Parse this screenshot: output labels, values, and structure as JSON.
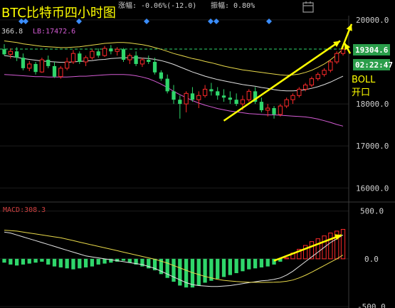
{
  "header": {
    "title": "BTC比特币四小时图",
    "change_label": "涨幅:",
    "change_value": "-0.06%(-12.0)",
    "amplitude_label": "振幅:",
    "amplitude_value": "0.80%",
    "boll_mid_partial": "366.8",
    "boll_lb": "LB:17472.6",
    "icon_name": "calendar-icon"
  },
  "price_axis": {
    "ticks": [
      "20000.0",
      "19304.6",
      "18000.0",
      "17000.0",
      "16000.0"
    ],
    "current_price": "19304.6",
    "countdown": "02:22:47"
  },
  "annotation": {
    "line1": "BOLL",
    "line2": "开口"
  },
  "macd": {
    "label": "MACD:308.3",
    "ticks": [
      "500.0",
      "0.0",
      "-500.0"
    ]
  },
  "colors": {
    "up": "#ff2a2a",
    "down": "#2fd66b",
    "boll_mid": "#e0e0e0",
    "boll_upper": "#e8d94a",
    "boll_lower": "#d45cd4",
    "arrow": "#ffff00",
    "diamond": "#3a8dff",
    "price_tag": "#2a9d4a"
  },
  "chart_data": {
    "type": "candlestick",
    "title": "BTC比特币四小时图",
    "ylim": [
      15700,
      20100
    ],
    "candles": [
      {
        "o": 19300,
        "h": 19420,
        "l": 19150,
        "c": 19180
      },
      {
        "o": 19180,
        "h": 19320,
        "l": 19080,
        "c": 19250
      },
      {
        "o": 19250,
        "h": 19350,
        "l": 19020,
        "c": 19100
      },
      {
        "o": 19100,
        "h": 19200,
        "l": 18800,
        "c": 18850
      },
      {
        "o": 18850,
        "h": 19020,
        "l": 18780,
        "c": 18950
      },
      {
        "o": 18950,
        "h": 19000,
        "l": 18700,
        "c": 18760
      },
      {
        "o": 18760,
        "h": 19100,
        "l": 18740,
        "c": 19050
      },
      {
        "o": 19050,
        "h": 19150,
        "l": 18850,
        "c": 18900
      },
      {
        "o": 18900,
        "h": 19000,
        "l": 18620,
        "c": 18650
      },
      {
        "o": 18650,
        "h": 18900,
        "l": 18600,
        "c": 18850
      },
      {
        "o": 18850,
        "h": 19100,
        "l": 18800,
        "c": 19000
      },
      {
        "o": 19000,
        "h": 19280,
        "l": 18950,
        "c": 19200
      },
      {
        "o": 19200,
        "h": 19250,
        "l": 18950,
        "c": 19000
      },
      {
        "o": 19000,
        "h": 19150,
        "l": 18900,
        "c": 19100
      },
      {
        "o": 19100,
        "h": 19300,
        "l": 19050,
        "c": 19250
      },
      {
        "o": 19250,
        "h": 19320,
        "l": 19100,
        "c": 19150
      },
      {
        "o": 19150,
        "h": 19380,
        "l": 19120,
        "c": 19320
      },
      {
        "o": 19320,
        "h": 19400,
        "l": 19180,
        "c": 19250
      },
      {
        "o": 19250,
        "h": 19350,
        "l": 19150,
        "c": 19300
      },
      {
        "o": 19300,
        "h": 19330,
        "l": 19000,
        "c": 19050
      },
      {
        "o": 19050,
        "h": 19200,
        "l": 18950,
        "c": 19150
      },
      {
        "o": 19150,
        "h": 19250,
        "l": 18900,
        "c": 18950
      },
      {
        "o": 18950,
        "h": 19100,
        "l": 18880,
        "c": 19050
      },
      {
        "o": 19050,
        "h": 19150,
        "l": 18950,
        "c": 19000
      },
      {
        "o": 19000,
        "h": 19100,
        "l": 18700,
        "c": 18750
      },
      {
        "o": 18750,
        "h": 18800,
        "l": 18550,
        "c": 18600
      },
      {
        "o": 18600,
        "h": 18700,
        "l": 18250,
        "c": 18300
      },
      {
        "o": 18300,
        "h": 18450,
        "l": 18000,
        "c": 18100
      },
      {
        "o": 18100,
        "h": 18200,
        "l": 17650,
        "c": 18000
      },
      {
        "o": 18000,
        "h": 18300,
        "l": 17800,
        "c": 18250
      },
      {
        "o": 18250,
        "h": 18400,
        "l": 18050,
        "c": 18100
      },
      {
        "o": 18100,
        "h": 18300,
        "l": 17900,
        "c": 18200
      },
      {
        "o": 18200,
        "h": 18450,
        "l": 18150,
        "c": 18350
      },
      {
        "o": 18350,
        "h": 18500,
        "l": 18200,
        "c": 18300
      },
      {
        "o": 18300,
        "h": 18400,
        "l": 18100,
        "c": 18200
      },
      {
        "o": 18200,
        "h": 18350,
        "l": 18050,
        "c": 18150
      },
      {
        "o": 18150,
        "h": 18300,
        "l": 18000,
        "c": 18100
      },
      {
        "o": 18100,
        "h": 18250,
        "l": 17950,
        "c": 18000
      },
      {
        "o": 18000,
        "h": 18200,
        "l": 17850,
        "c": 18100
      },
      {
        "o": 18100,
        "h": 18350,
        "l": 18050,
        "c": 18300
      },
      {
        "o": 18300,
        "h": 18400,
        "l": 18000,
        "c": 18050
      },
      {
        "o": 18050,
        "h": 18150,
        "l": 17800,
        "c": 17850
      },
      {
        "o": 17850,
        "h": 18000,
        "l": 17700,
        "c": 17900
      },
      {
        "o": 17900,
        "h": 17950,
        "l": 17650,
        "c": 17750
      },
      {
        "o": 17750,
        "h": 18000,
        "l": 17700,
        "c": 17950
      },
      {
        "o": 17950,
        "h": 18150,
        "l": 17900,
        "c": 18100
      },
      {
        "o": 18100,
        "h": 18250,
        "l": 18000,
        "c": 18200
      },
      {
        "o": 18200,
        "h": 18400,
        "l": 18150,
        "c": 18350
      },
      {
        "o": 18350,
        "h": 18500,
        "l": 18300,
        "c": 18450
      },
      {
        "o": 18450,
        "h": 18650,
        "l": 18400,
        "c": 18600
      },
      {
        "o": 18600,
        "h": 18750,
        "l": 18550,
        "c": 18700
      },
      {
        "o": 18700,
        "h": 18850,
        "l": 18650,
        "c": 18800
      },
      {
        "o": 18800,
        "h": 19050,
        "l": 18750,
        "c": 19000
      },
      {
        "o": 19000,
        "h": 19250,
        "l": 18950,
        "c": 19200
      },
      {
        "o": 19200,
        "h": 19350,
        "l": 19150,
        "c": 19304.6
      }
    ],
    "boll_mid": [
      19150,
      19130,
      19110,
      19080,
      19060,
      19040,
      19020,
      19010,
      19000,
      18990,
      18990,
      19000,
      19010,
      19020,
      19030,
      19050,
      19060,
      19080,
      19090,
      19100,
      19100,
      19100,
      19090,
      19080,
      19060,
      19030,
      18990,
      18940,
      18880,
      18820,
      18760,
      18710,
      18660,
      18620,
      18580,
      18550,
      18520,
      18490,
      18460,
      18440,
      18420,
      18390,
      18370,
      18340,
      18320,
      18310,
      18310,
      18320,
      18340,
      18370,
      18410,
      18460,
      18520,
      18590,
      18660
    ],
    "boll_upper": [
      19500,
      19480,
      19460,
      19430,
      19410,
      19390,
      19370,
      19360,
      19350,
      19340,
      19340,
      19350,
      19360,
      19380,
      19400,
      19420,
      19440,
      19450,
      19460,
      19460,
      19450,
      19430,
      19410,
      19380,
      19340,
      19300,
      19250,
      19200,
      19160,
      19120,
      19080,
      19050,
      19010,
      18980,
      18940,
      18900,
      18870,
      18840,
      18810,
      18790,
      18770,
      18750,
      18730,
      18710,
      18690,
      18680,
      18690,
      18710,
      18750,
      18800,
      18870,
      18950,
      19050,
      19170,
      19300
    ],
    "boll_lower": [
      18700,
      18690,
      18680,
      18670,
      18660,
      18650,
      18650,
      18640,
      18640,
      18640,
      18640,
      18650,
      18660,
      18660,
      18670,
      18680,
      18690,
      18700,
      18700,
      18700,
      18690,
      18670,
      18640,
      18600,
      18540,
      18470,
      18390,
      18300,
      18220,
      18150,
      18080,
      18020,
      17970,
      17930,
      17890,
      17860,
      17830,
      17810,
      17790,
      17770,
      17760,
      17750,
      17740,
      17740,
      17730,
      17720,
      17710,
      17700,
      17690,
      17670,
      17640,
      17600,
      17560,
      17510,
      17472.6
    ],
    "macd_hist": [
      -40,
      -60,
      -70,
      -60,
      -50,
      -40,
      -30,
      -60,
      -80,
      -90,
      -100,
      -110,
      -100,
      -90,
      -80,
      -60,
      -50,
      -40,
      -30,
      -20,
      -40,
      -60,
      -80,
      -100,
      -120,
      -160,
      -200,
      -240,
      -280,
      -300,
      -300,
      -280,
      -250,
      -230,
      -210,
      -190,
      -170,
      -150,
      -130,
      -110,
      -100,
      -90,
      -80,
      -60,
      -30,
      10,
      60,
      100,
      140,
      180,
      210,
      240,
      270,
      290,
      308.3
    ],
    "macd_dif": [
      280,
      270,
      250,
      230,
      210,
      190,
      170,
      150,
      130,
      110,
      90,
      70,
      50,
      30,
      20,
      10,
      0,
      -10,
      -20,
      -30,
      -40,
      -50,
      -60,
      -80,
      -100,
      -130,
      -160,
      -190,
      -220,
      -250,
      -270,
      -280,
      -285,
      -290,
      -290,
      -285,
      -280,
      -270,
      -260,
      -250,
      -240,
      -230,
      -225,
      -215,
      -200,
      -170,
      -130,
      -80,
      -30,
      20,
      70,
      120,
      170,
      210,
      250
    ],
    "macd_dea": [
      300,
      295,
      290,
      280,
      270,
      260,
      250,
      240,
      230,
      220,
      205,
      190,
      175,
      160,
      145,
      130,
      115,
      100,
      85,
      70,
      55,
      40,
      25,
      10,
      -5,
      -25,
      -45,
      -70,
      -95,
      -120,
      -145,
      -165,
      -185,
      -200,
      -215,
      -225,
      -232,
      -238,
      -242,
      -245,
      -246,
      -247,
      -246,
      -245,
      -242,
      -235,
      -222,
      -200,
      -172,
      -140,
      -105,
      -70,
      -35,
      0,
      40
    ],
    "macd_ylim": [
      -500,
      550
    ]
  }
}
